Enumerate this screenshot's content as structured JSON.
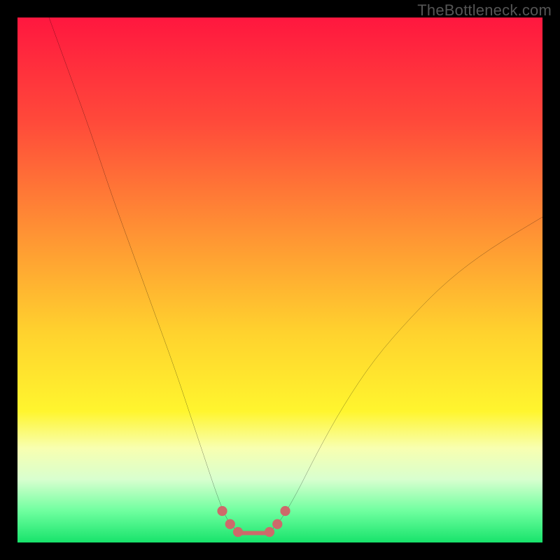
{
  "watermark": "TheBottleneck.com",
  "chart_data": {
    "type": "line",
    "title": "",
    "xlabel": "",
    "ylabel": "",
    "xlim": [
      0,
      100
    ],
    "ylim": [
      0,
      100
    ],
    "gradient_stops": [
      {
        "offset": 0,
        "color": "#ff173f"
      },
      {
        "offset": 20,
        "color": "#ff4a3a"
      },
      {
        "offset": 40,
        "color": "#ff8f34"
      },
      {
        "offset": 60,
        "color": "#ffd22e"
      },
      {
        "offset": 75,
        "color": "#fff52e"
      },
      {
        "offset": 82,
        "color": "#f8ffb0"
      },
      {
        "offset": 88,
        "color": "#d8ffcf"
      },
      {
        "offset": 94,
        "color": "#6fff9f"
      },
      {
        "offset": 100,
        "color": "#17e36b"
      }
    ],
    "series": [
      {
        "name": "bottleneck-curve",
        "color": "#000000",
        "width": 1.8,
        "points": [
          {
            "x": 6,
            "y": 100
          },
          {
            "x": 10,
            "y": 89
          },
          {
            "x": 14,
            "y": 78
          },
          {
            "x": 18,
            "y": 66
          },
          {
            "x": 22,
            "y": 55
          },
          {
            "x": 26,
            "y": 44
          },
          {
            "x": 30,
            "y": 33
          },
          {
            "x": 33,
            "y": 24
          },
          {
            "x": 36,
            "y": 15
          },
          {
            "x": 38,
            "y": 9
          },
          {
            "x": 40,
            "y": 4
          },
          {
            "x": 42,
            "y": 2
          },
          {
            "x": 44,
            "y": 1.5
          },
          {
            "x": 46,
            "y": 1.5
          },
          {
            "x": 48,
            "y": 2
          },
          {
            "x": 50,
            "y": 4
          },
          {
            "x": 53,
            "y": 9
          },
          {
            "x": 57,
            "y": 17
          },
          {
            "x": 62,
            "y": 26
          },
          {
            "x": 68,
            "y": 35
          },
          {
            "x": 75,
            "y": 43
          },
          {
            "x": 82,
            "y": 50
          },
          {
            "x": 90,
            "y": 56
          },
          {
            "x": 100,
            "y": 62
          }
        ]
      }
    ],
    "bottom_markers": {
      "color": "#cd6a6a",
      "dots": [
        {
          "x": 39,
          "y": 6
        },
        {
          "x": 40.5,
          "y": 3.5
        },
        {
          "x": 42,
          "y": 2
        },
        {
          "x": 48,
          "y": 2
        },
        {
          "x": 49.5,
          "y": 3.5
        },
        {
          "x": 51,
          "y": 6
        }
      ],
      "segment": {
        "x1": 42,
        "y1": 1.8,
        "x2": 48,
        "y2": 1.8,
        "width": 6
      }
    }
  }
}
